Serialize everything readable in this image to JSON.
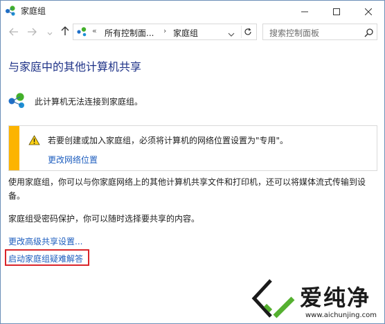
{
  "window": {
    "title": "家庭组",
    "colors": {
      "accent_link": "#1e5ebf",
      "title_blue": "#1e3287",
      "warning_bar": "#fcb400",
      "highlight_red": "#d9242a"
    }
  },
  "icons": {
    "app": "homegroup-icon",
    "minimize": "minimize-icon",
    "maximize": "maximize-icon",
    "close": "close-icon",
    "back": "arrow-left-icon",
    "forward": "arrow-right-icon",
    "recent": "chevron-down-icon",
    "up": "arrow-up-icon",
    "refresh": "refresh-icon",
    "search": "search-icon",
    "warning": "warning-icon"
  },
  "address": {
    "chevron": "«",
    "segment1": "所有控制面...",
    "separator": "›",
    "segment2": "家庭组"
  },
  "search": {
    "placeholder": "搜索控制面板"
  },
  "main": {
    "title": "与家庭中的其他计算机共享",
    "status": "此计算机无法连接到家庭组。",
    "warning": {
      "text": "若要创建或加入家庭组，必须将计算机的网络位置设置为\"专用\"。",
      "link": "更改网络位置"
    },
    "description": "使用家庭组，你可以与你家庭网络上的其他计算机共享文件和打印机，还可以将媒体流式传输到设备。",
    "password_note": "家庭组受密码保护，你可以随时选择要共享的内容。",
    "links": {
      "advanced": "更改高级共享设置...",
      "troubleshoot": "启动家庭组疑难解答"
    }
  },
  "watermark": {
    "text": "爱纯净",
    "url": "www.aichunjing.com"
  }
}
